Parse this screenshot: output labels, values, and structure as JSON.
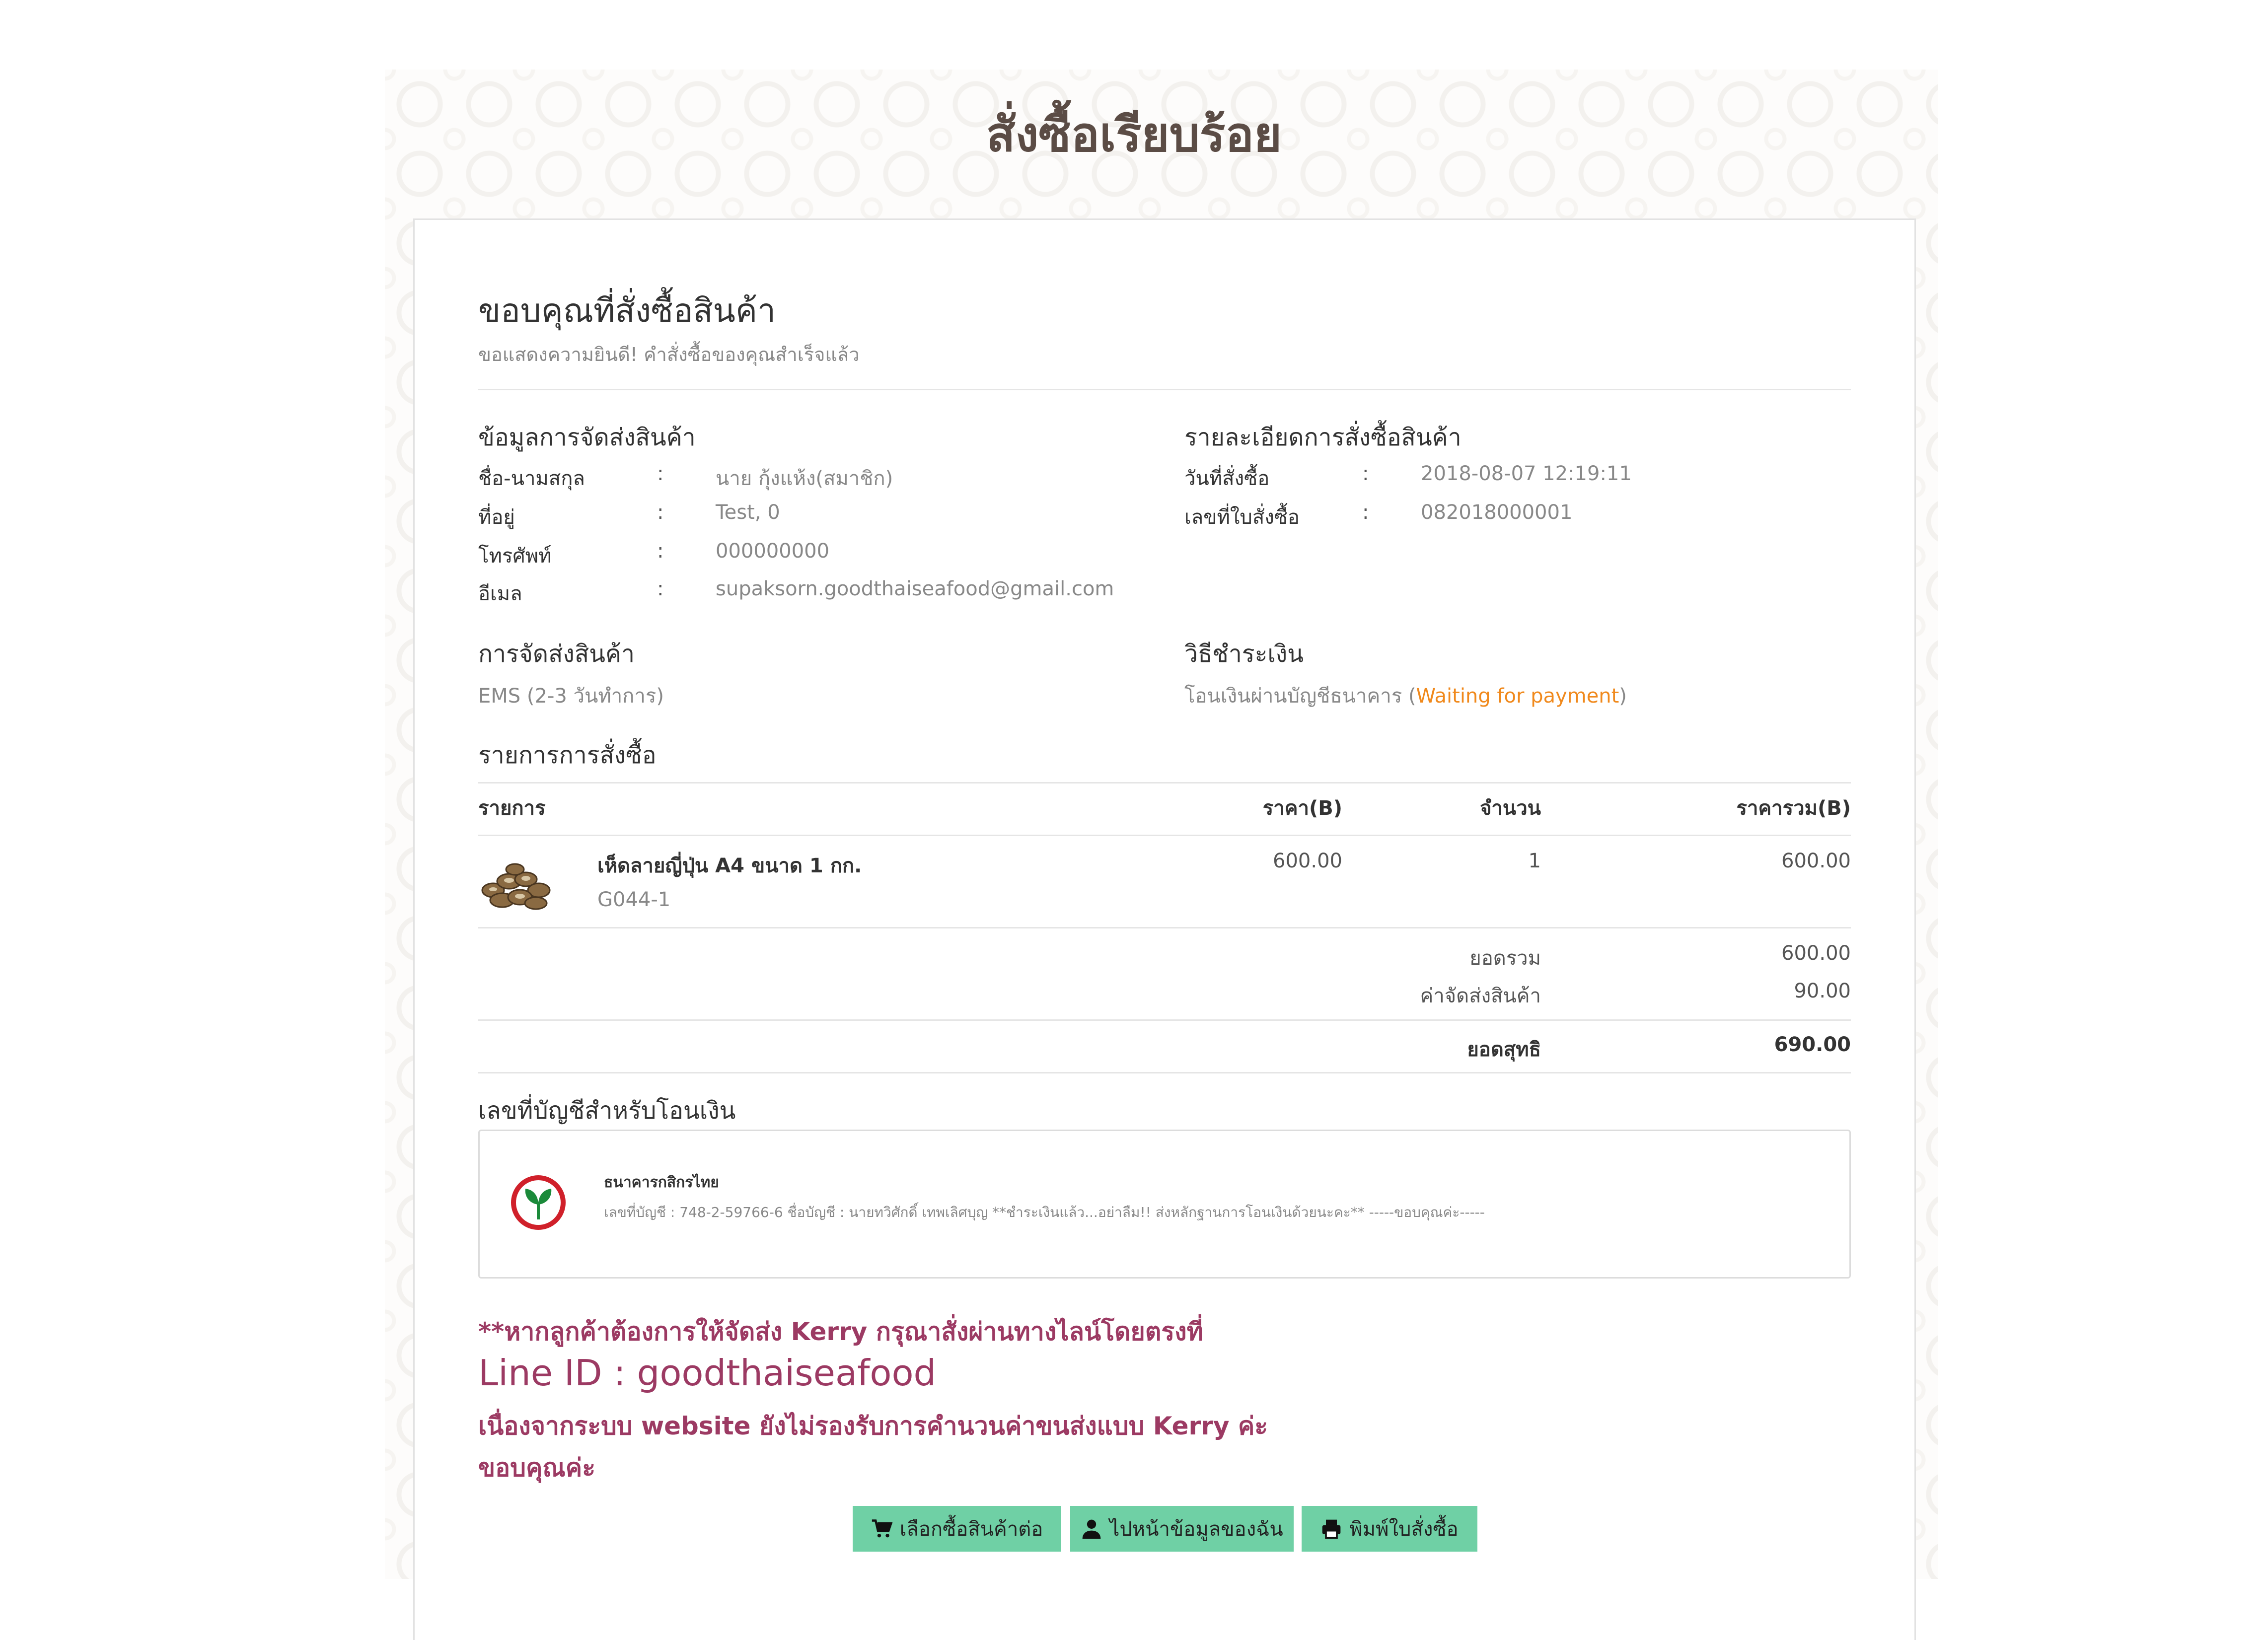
{
  "page_title": "สั่งซื้อเรียบร้อย",
  "thanks": {
    "title": "ขอบคุณที่สั่งซื้อสินค้า",
    "subtitle": "ขอแสดงความยินดี! คำสั่งซื้อของคุณสำเร็จแล้ว"
  },
  "shipping_info": {
    "heading": "ข้อมูลการจัดส่งสินค้า",
    "rows": [
      {
        "label": "ชื่อ-นามสกุล",
        "colon": ":",
        "value": "นาย กุ้งแห้ง(สมาชิก)"
      },
      {
        "label": "ที่อยู่",
        "colon": ":",
        "value": "Test, 0"
      },
      {
        "label": "โทรศัพท์",
        "colon": ":",
        "value": "000000000"
      },
      {
        "label": "อีเมล",
        "colon": ":",
        "value": "supaksorn.goodthaiseafood@gmail.com"
      }
    ]
  },
  "order_details": {
    "heading": "รายละเอียดการสั่งซื้อสินค้า",
    "rows": [
      {
        "label": "วันที่สั่งซื้อ",
        "colon": ":",
        "value": "2018-08-07 12:19:11"
      },
      {
        "label": "เลขที่ใบสั่งซื้อ",
        "colon": ":",
        "value": "082018000001"
      }
    ]
  },
  "delivery": {
    "heading": "การจัดส่งสินค้า",
    "value": "EMS (2-3 วันทำการ)"
  },
  "payment": {
    "heading": "วิธีชำระเงิน",
    "method": "โอนเงินผ่านบัญชีธนาคาร",
    "open": "(",
    "status": "Waiting for payment",
    "close": ")",
    "status_color": "#f0891c"
  },
  "order_list": {
    "heading": "รายการการสั่งซื้อ",
    "columns": {
      "item": "รายการ",
      "price": "ราคา(B)",
      "qty": "จำนวน",
      "total": "ราคารวม(B)"
    },
    "items": [
      {
        "name": "เห็ดลายญี่ปุ่น A4 ขนาด 1 กก.",
        "sku": "G044-1",
        "price": "600.00",
        "qty": "1",
        "total": "600.00",
        "image": "mushroom-image"
      }
    ],
    "subtotal_label": "ยอดรวม",
    "subtotal": "600.00",
    "shipping_label": "ค่าจัดส่งสินค้า",
    "shipping": "90.00",
    "grand_label": "ยอดสุทธิ",
    "grand": "690.00"
  },
  "bank": {
    "heading": "เลขที่บัญชีสำหรับโอนเงิน",
    "name": "ธนาคารกสิกรไทย",
    "detail": "เลขที่บัญชี : 748-2-59766-6 ชื่อบัญชี : นายทวิศักดิ์ เทพเลิศบุญ **ชำระเงินแล้ว...อย่าลืม!! ส่งหลักฐานการโอนเงินด้วยนะคะ** -----ขอบคุณค่ะ-----",
    "logo": "kasikorn-logo",
    "logo_color": "#d0202a",
    "logo_leaf_color": "#1b8a3a"
  },
  "notice": {
    "line1": "**หากลูกค้าต้องการให้จัดส่ง Kerry กรุณาสั่งผ่านทางไลน์โดยตรงที่",
    "line2": "Line ID : goodthaiseafood",
    "line3": "เนื่องจากระบบ website ยังไม่รองรับการคำนวนค่าขนส่งแบบ Kerry ค่ะ",
    "line4": "ขอบคุณค่ะ",
    "color": "#9c3a63"
  },
  "buttons": {
    "continue_shopping": "เลือกซื้อสินค้าต่อ",
    "my_account": "ไปหน้าข้อมูลของฉัน",
    "print_order": "พิมพ์ใบสั่งซื้อ",
    "continue_icon": "cart-icon",
    "account_icon": "user-icon",
    "print_icon": "print-icon",
    "color": "#6fd0a5"
  }
}
